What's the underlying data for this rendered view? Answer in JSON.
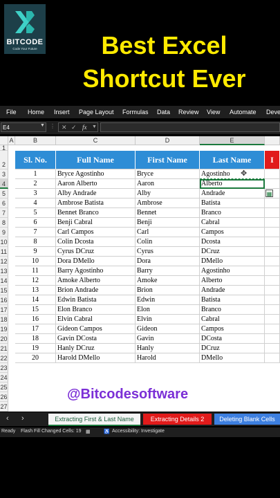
{
  "brand": {
    "name": "BITCODE",
    "tagline": "Code Your Future",
    "accent": "#1d3f49"
  },
  "headline": {
    "line1": "Best Excel",
    "line2": "Shortcut Ever",
    "color": "#ffea00"
  },
  "ribbon": {
    "menus": [
      "File",
      "Home",
      "Insert",
      "Page Layout",
      "Formulas",
      "Data",
      "Review",
      "View",
      "Automate",
      "Deve"
    ]
  },
  "formula_bar": {
    "name_box": "E4",
    "formula": ""
  },
  "columns": [
    "A",
    "B",
    "C",
    "D",
    "E"
  ],
  "rows": [
    "1",
    "2",
    "3",
    "4",
    "5",
    "6",
    "7",
    "8",
    "9",
    "10",
    "11",
    "12",
    "13",
    "14",
    "15",
    "16",
    "17",
    "18",
    "19",
    "20",
    "21",
    "22",
    "23",
    "24",
    "25",
    "26",
    "27",
    "28"
  ],
  "table": {
    "headers": [
      "Sl. No.",
      "Full Name",
      "First Name",
      "Last Name",
      "I"
    ],
    "records": [
      [
        "1",
        "Bryce Agostinho",
        "Bryce",
        "Agostinho"
      ],
      [
        "2",
        "Aaron Alberto",
        "Aaron",
        "Alberto"
      ],
      [
        "3",
        "Alby Andrade",
        "Alby",
        "Andrade"
      ],
      [
        "4",
        "Ambrose Batista",
        "Ambrose",
        "Batista"
      ],
      [
        "5",
        "Bennet Branco",
        "Bennet",
        "Branco"
      ],
      [
        "6",
        "Benji Cabral",
        "Benji",
        "Cabral"
      ],
      [
        "7",
        "Carl Campos",
        "Carl",
        "Campos"
      ],
      [
        "8",
        "Colin Dcosta",
        "Colin",
        "Dcosta"
      ],
      [
        "9",
        "Cyrus DCruz",
        "Cyrus",
        "DCruz"
      ],
      [
        "10",
        "Dora DMello",
        "Dora",
        "DMello"
      ],
      [
        "11",
        "Barry Agostinho",
        "Barry",
        "Agostinho"
      ],
      [
        "12",
        "Amoke Alberto",
        "Amoke",
        "Alberto"
      ],
      [
        "13",
        "Brion Andrade",
        "Brion",
        "Andrade"
      ],
      [
        "14",
        "Edwin Batista",
        "Edwin",
        "Batista"
      ],
      [
        "15",
        "Elon Branco",
        "Elon",
        "Branco"
      ],
      [
        "16",
        "Elvin Cabral",
        "Elvin",
        "Cabral"
      ],
      [
        "17",
        "Gideon Campos",
        "Gideon",
        "Campos"
      ],
      [
        "18",
        "Gavin DCosta",
        "Gavin",
        "DCosta"
      ],
      [
        "19",
        "Hanly DCruz",
        "Hanly",
        "DCruz"
      ],
      [
        "20",
        "Harold DMello",
        "Harold",
        "DMello"
      ]
    ]
  },
  "watermark": "@Bitcodesoftware",
  "sheet_tabs": [
    "Extracting First & Last Name",
    "Extracting Details 2",
    "Deleting Blank Cells"
  ],
  "status_bar": {
    "ready": "Ready",
    "flash_fill": "Flash Fill Changed Cells: 19",
    "accessibility": "Accessibility: Investigate"
  },
  "colors": {
    "header_fill": "#2e8dd6",
    "selection": "#1b7a3d",
    "tab_red": "#e11b1b",
    "tab_blue": "#3d7fe0"
  }
}
